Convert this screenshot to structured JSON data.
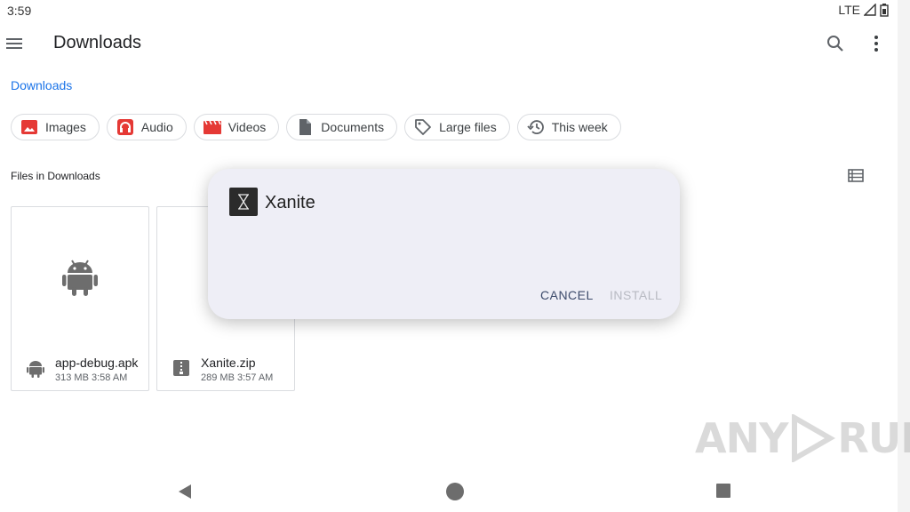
{
  "status_bar": {
    "time": "3:59",
    "network": "LTE"
  },
  "app_bar": {
    "title": "Downloads",
    "menu_icon": "menu-icon",
    "search_icon": "search-icon",
    "more_icon": "more-vert-icon"
  },
  "breadcrumb": "Downloads",
  "chips": [
    {
      "label": "Images",
      "icon": "image-icon",
      "color": "#e53935"
    },
    {
      "label": "Audio",
      "icon": "headphones-icon",
      "color": "#e53935"
    },
    {
      "label": "Videos",
      "icon": "movie-icon",
      "color": "#e53935"
    },
    {
      "label": "Documents",
      "icon": "document-icon",
      "color": "#5f6368"
    },
    {
      "label": "Large files",
      "icon": "tag-icon",
      "color": "#5f6368"
    },
    {
      "label": "This week",
      "icon": "history-icon",
      "color": "#5f6368"
    }
  ],
  "section_label": "Files in Downloads",
  "files": [
    {
      "name": "app-debug.apk",
      "meta": "313 MB 3:58 AM",
      "icon": "android-icon"
    },
    {
      "name": "Xanite.zip",
      "meta": "289 MB 3:57 AM",
      "icon": "zip-icon"
    }
  ],
  "dialog": {
    "app_name": "Xanite",
    "cancel": "CANCEL",
    "install": "INSTALL"
  },
  "watermark": {
    "left": "ANY",
    "right": "RUN"
  }
}
